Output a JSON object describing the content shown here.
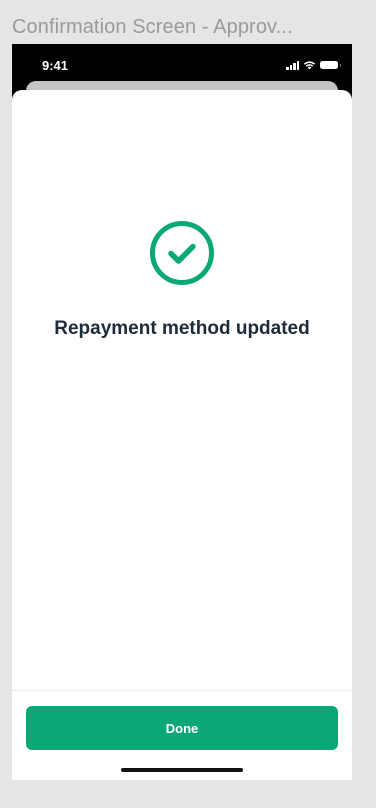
{
  "frame": {
    "title": "Confirmation Screen - Approv..."
  },
  "status_bar": {
    "time": "9:41",
    "icons": [
      "signal-icon",
      "wifi-icon",
      "battery-icon"
    ]
  },
  "confirmation": {
    "icon": "check-circle-icon",
    "message": "Repayment method updated"
  },
  "footer": {
    "done_label": "Done"
  },
  "colors": {
    "accent": "#0aa876",
    "text_primary": "#1d2b3a",
    "background": "#ffffff",
    "canvas": "#e5e5e5"
  }
}
